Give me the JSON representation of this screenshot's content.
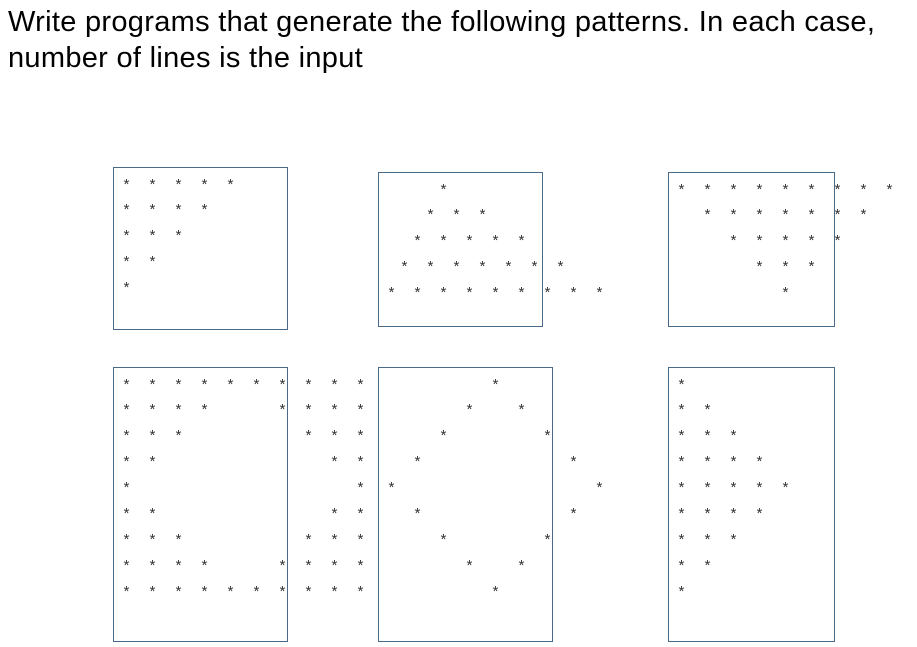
{
  "instruction": "Write programs that generate the following patterns. In each case, number of lines is the input",
  "patterns": {
    "p1": "* * * * *\n* * * *\n* * *\n* *\n*",
    "p2": "    *\n   * * *\n  * * * * *\n * * * * * * *\n* * * * * * * * *",
    "p3": "* * * * * * * * *\n  * * * * * * *\n    * * * * *\n      * * *\n        *",
    "p4": "* * * * * * * * * *\n* * * *     * * * *\n* * *         * * *\n* *             * *\n*                 *\n* *             * *\n* * *         * * *\n* * * *     * * * *\n* * * * * * * * * *",
    "p5": "        *\n      *   *\n    *       *\n  *           *\n*               *\n  *           *\n    *       *\n      *   *\n        *",
    "p6": "*\n* *\n* * *\n* * * *\n* * * * *\n* * * *\n* * *\n* *\n*"
  }
}
